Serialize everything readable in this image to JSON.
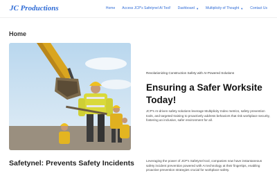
{
  "header": {
    "logo_text": "JC Productions",
    "nav": [
      {
        "label": "Home"
      },
      {
        "label": "Access JCP's Safetynel AI Tool!"
      },
      {
        "label": "Dashboard",
        "chevron": "chevron-down-icon"
      },
      {
        "label": "Multiplicity of Thought",
        "chevron": "chevron-down-icon"
      },
      {
        "label": "Contact Us"
      }
    ]
  },
  "page": {
    "title": "Home"
  },
  "hero": {
    "image": "construction-workers-excavator-photo",
    "eyebrow": "Revolutionizing Construction Safety with AI-Powered Solutions",
    "headline": "Ensuring a Safer Worksite Today!",
    "intro": "JCP's AI-driven safety solutions leverage Multiplicity Index metrics, safety prevention tools, and targeted training to proactively address behaviors that risk workplace security, fostering an inclusive, safer environment for all."
  },
  "section": {
    "title": "Safetynel: Prevents Safety Incidents",
    "text": "Leveraging the power of JCP's Safetynel tool, companies now have instantaneous safety incident prevention powered with AI technology at their fingertips, enabling proactive prevention strategies crucial for workplace safety."
  },
  "colors": {
    "brand_blue": "#2e6bd6",
    "text_dark": "#111111"
  }
}
